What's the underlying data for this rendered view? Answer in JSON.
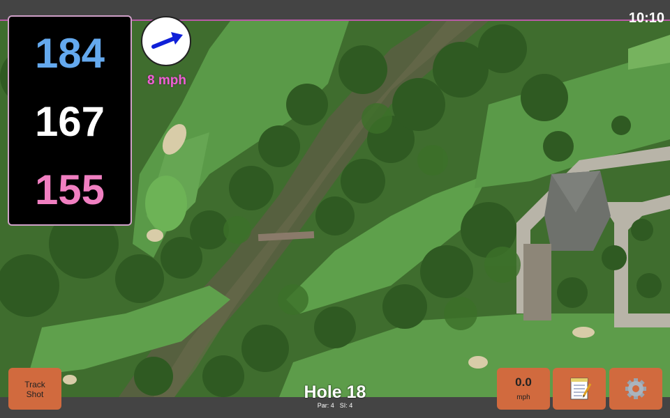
{
  "status": {
    "time": "10:10"
  },
  "distances": {
    "back": "184",
    "middle": "167",
    "front": "155"
  },
  "wind": {
    "speed_label": "8 mph",
    "arrow_icon": "wind-direction-arrow-icon"
  },
  "buttons": {
    "track_shot_line1": "Track",
    "track_shot_line2": "Shot",
    "speed_value": "0.0",
    "speed_unit": "mph",
    "notes_icon": "notepad-icon",
    "settings_icon": "gear-icon"
  },
  "hole": {
    "title": "Hole 18",
    "par": "Par: 4",
    "si": "SI: 4"
  },
  "colors": {
    "back": "#64a9ee",
    "middle": "#ffffff",
    "front": "#f07fc1",
    "wind_text": "#f05fd4",
    "button": "#d16a3e",
    "bar": "#444444"
  }
}
